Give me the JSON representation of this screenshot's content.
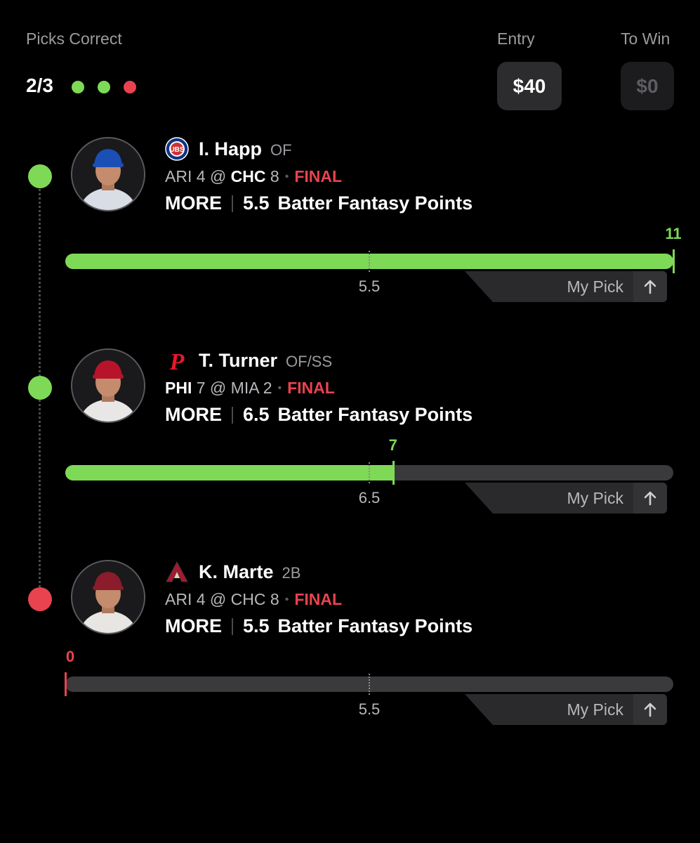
{
  "header": {
    "picks_correct_label": "Picks Correct",
    "score": "2/3",
    "indicators": [
      "#7ed957",
      "#7ed957",
      "#e8434f"
    ],
    "entry_label": "Entry",
    "entry_value": "$40",
    "to_win_label": "To Win",
    "to_win_value": "$0"
  },
  "picks": [
    {
      "team_icon": "cubs-logo-icon",
      "name": "I. Happ",
      "position": "OF",
      "away_team": "ARI",
      "away_score": "4",
      "at": "@",
      "home_team": "CHC",
      "home_score": "8",
      "status": "FINAL",
      "direction": "MORE",
      "line_value": "5.5",
      "stat": "Batter Fantasy Points",
      "result": "11",
      "threshold": "5.5",
      "progress_fraction": 1.0,
      "threshold_fraction": 0.5,
      "outcome_color": "#7ed957",
      "my_pick_label": "My Pick",
      "jersey_color": "#d9dde6",
      "cap_color": "#1b4fb5"
    },
    {
      "team_icon": "phillies-logo-icon",
      "name": "T. Turner",
      "position": "OF/SS",
      "away_team": "PHI",
      "away_score": "7",
      "at": "@",
      "home_team": "MIA",
      "home_score": "2",
      "status": "FINAL",
      "direction": "MORE",
      "line_value": "6.5",
      "stat": "Batter Fantasy Points",
      "result": "7",
      "threshold": "6.5",
      "progress_fraction": 0.539,
      "threshold_fraction": 0.5,
      "outcome_color": "#7ed957",
      "my_pick_label": "My Pick",
      "jersey_color": "#e9e6e6",
      "cap_color": "#b7142b"
    },
    {
      "team_icon": "dbacks-logo-icon",
      "name": "K. Marte",
      "position": "2B",
      "away_team": "ARI",
      "away_score": "4",
      "at": "@",
      "home_team": "CHC",
      "home_score": "8",
      "status": "FINAL",
      "direction": "MORE",
      "line_value": "5.5",
      "stat": "Batter Fantasy Points",
      "result": "0",
      "threshold": "5.5",
      "progress_fraction": 0.0,
      "threshold_fraction": 0.5,
      "outcome_color": "#e8434f",
      "my_pick_label": "My Pick",
      "jersey_color": "#e8e6e2",
      "cap_color": "#8a1c2b"
    }
  ]
}
